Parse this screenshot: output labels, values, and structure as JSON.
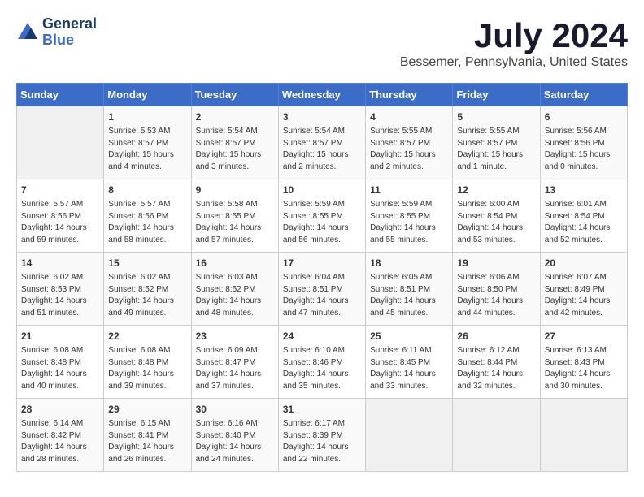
{
  "header": {
    "logo_line1": "General",
    "logo_line2": "Blue",
    "month_title": "July 2024",
    "location": "Bessemer, Pennsylvania, United States"
  },
  "days_of_week": [
    "Sunday",
    "Monday",
    "Tuesday",
    "Wednesday",
    "Thursday",
    "Friday",
    "Saturday"
  ],
  "weeks": [
    [
      {
        "day": "",
        "content": ""
      },
      {
        "day": "1",
        "content": "Sunrise: 5:53 AM\nSunset: 8:57 PM\nDaylight: 15 hours\nand 4 minutes."
      },
      {
        "day": "2",
        "content": "Sunrise: 5:54 AM\nSunset: 8:57 PM\nDaylight: 15 hours\nand 3 minutes."
      },
      {
        "day": "3",
        "content": "Sunrise: 5:54 AM\nSunset: 8:57 PM\nDaylight: 15 hours\nand 2 minutes."
      },
      {
        "day": "4",
        "content": "Sunrise: 5:55 AM\nSunset: 8:57 PM\nDaylight: 15 hours\nand 2 minutes."
      },
      {
        "day": "5",
        "content": "Sunrise: 5:55 AM\nSunset: 8:57 PM\nDaylight: 15 hours\nand 1 minute."
      },
      {
        "day": "6",
        "content": "Sunrise: 5:56 AM\nSunset: 8:56 PM\nDaylight: 15 hours\nand 0 minutes."
      }
    ],
    [
      {
        "day": "7",
        "content": "Sunrise: 5:57 AM\nSunset: 8:56 PM\nDaylight: 14 hours\nand 59 minutes."
      },
      {
        "day": "8",
        "content": "Sunrise: 5:57 AM\nSunset: 8:56 PM\nDaylight: 14 hours\nand 58 minutes."
      },
      {
        "day": "9",
        "content": "Sunrise: 5:58 AM\nSunset: 8:55 PM\nDaylight: 14 hours\nand 57 minutes."
      },
      {
        "day": "10",
        "content": "Sunrise: 5:59 AM\nSunset: 8:55 PM\nDaylight: 14 hours\nand 56 minutes."
      },
      {
        "day": "11",
        "content": "Sunrise: 5:59 AM\nSunset: 8:55 PM\nDaylight: 14 hours\nand 55 minutes."
      },
      {
        "day": "12",
        "content": "Sunrise: 6:00 AM\nSunset: 8:54 PM\nDaylight: 14 hours\nand 53 minutes."
      },
      {
        "day": "13",
        "content": "Sunrise: 6:01 AM\nSunset: 8:54 PM\nDaylight: 14 hours\nand 52 minutes."
      }
    ],
    [
      {
        "day": "14",
        "content": "Sunrise: 6:02 AM\nSunset: 8:53 PM\nDaylight: 14 hours\nand 51 minutes."
      },
      {
        "day": "15",
        "content": "Sunrise: 6:02 AM\nSunset: 8:52 PM\nDaylight: 14 hours\nand 49 minutes."
      },
      {
        "day": "16",
        "content": "Sunrise: 6:03 AM\nSunset: 8:52 PM\nDaylight: 14 hours\nand 48 minutes."
      },
      {
        "day": "17",
        "content": "Sunrise: 6:04 AM\nSunset: 8:51 PM\nDaylight: 14 hours\nand 47 minutes."
      },
      {
        "day": "18",
        "content": "Sunrise: 6:05 AM\nSunset: 8:51 PM\nDaylight: 14 hours\nand 45 minutes."
      },
      {
        "day": "19",
        "content": "Sunrise: 6:06 AM\nSunset: 8:50 PM\nDaylight: 14 hours\nand 44 minutes."
      },
      {
        "day": "20",
        "content": "Sunrise: 6:07 AM\nSunset: 8:49 PM\nDaylight: 14 hours\nand 42 minutes."
      }
    ],
    [
      {
        "day": "21",
        "content": "Sunrise: 6:08 AM\nSunset: 8:48 PM\nDaylight: 14 hours\nand 40 minutes."
      },
      {
        "day": "22",
        "content": "Sunrise: 6:08 AM\nSunset: 8:48 PM\nDaylight: 14 hours\nand 39 minutes."
      },
      {
        "day": "23",
        "content": "Sunrise: 6:09 AM\nSunset: 8:47 PM\nDaylight: 14 hours\nand 37 minutes."
      },
      {
        "day": "24",
        "content": "Sunrise: 6:10 AM\nSunset: 8:46 PM\nDaylight: 14 hours\nand 35 minutes."
      },
      {
        "day": "25",
        "content": "Sunrise: 6:11 AM\nSunset: 8:45 PM\nDaylight: 14 hours\nand 33 minutes."
      },
      {
        "day": "26",
        "content": "Sunrise: 6:12 AM\nSunset: 8:44 PM\nDaylight: 14 hours\nand 32 minutes."
      },
      {
        "day": "27",
        "content": "Sunrise: 6:13 AM\nSunset: 8:43 PM\nDaylight: 14 hours\nand 30 minutes."
      }
    ],
    [
      {
        "day": "28",
        "content": "Sunrise: 6:14 AM\nSunset: 8:42 PM\nDaylight: 14 hours\nand 28 minutes."
      },
      {
        "day": "29",
        "content": "Sunrise: 6:15 AM\nSunset: 8:41 PM\nDaylight: 14 hours\nand 26 minutes."
      },
      {
        "day": "30",
        "content": "Sunrise: 6:16 AM\nSunset: 8:40 PM\nDaylight: 14 hours\nand 24 minutes."
      },
      {
        "day": "31",
        "content": "Sunrise: 6:17 AM\nSunset: 8:39 PM\nDaylight: 14 hours\nand 22 minutes."
      },
      {
        "day": "",
        "content": ""
      },
      {
        "day": "",
        "content": ""
      },
      {
        "day": "",
        "content": ""
      }
    ]
  ]
}
